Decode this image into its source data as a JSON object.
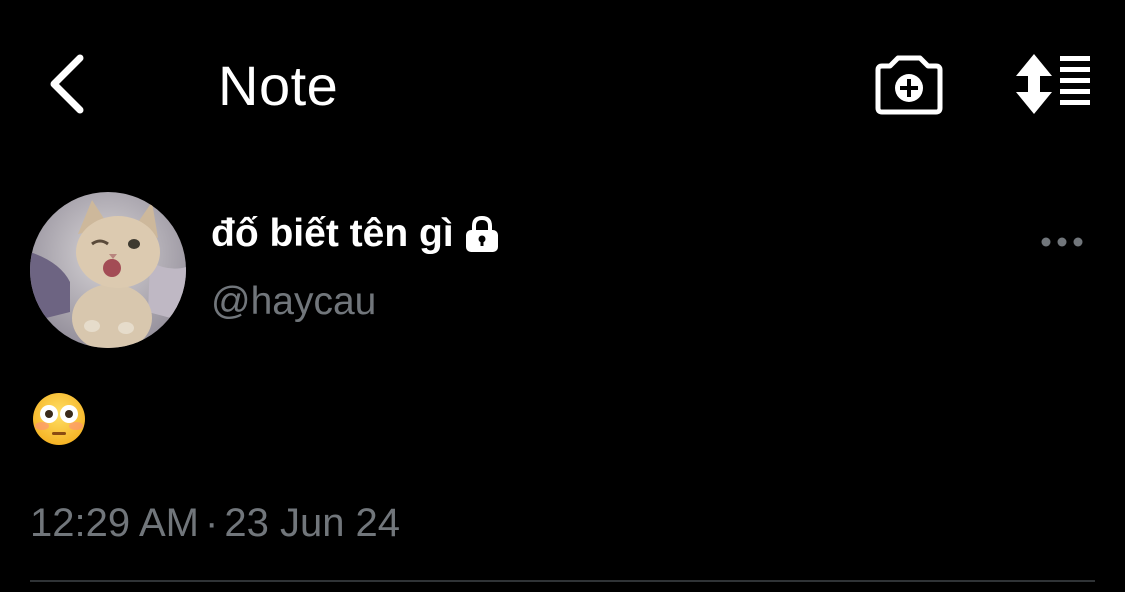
{
  "header": {
    "title": "Note",
    "back_icon": "chevron-left-icon",
    "camera_icon": "camera-plus-icon",
    "sort_icon": "sort-list-icon"
  },
  "author": {
    "display_name": "đố biết tên gì",
    "handle": "@haycau",
    "locked": true,
    "avatar": "kitten-avatar"
  },
  "note": {
    "text": "😳",
    "emoji_icon": "flushed-face-emoji"
  },
  "timestamp": {
    "time": "12:29 AM",
    "separator": "·",
    "date": "23 Jun 24"
  },
  "colors": {
    "background": "#000000",
    "text": "#ffffff",
    "secondary_text": "#71767b",
    "divider": "#2f3336"
  }
}
